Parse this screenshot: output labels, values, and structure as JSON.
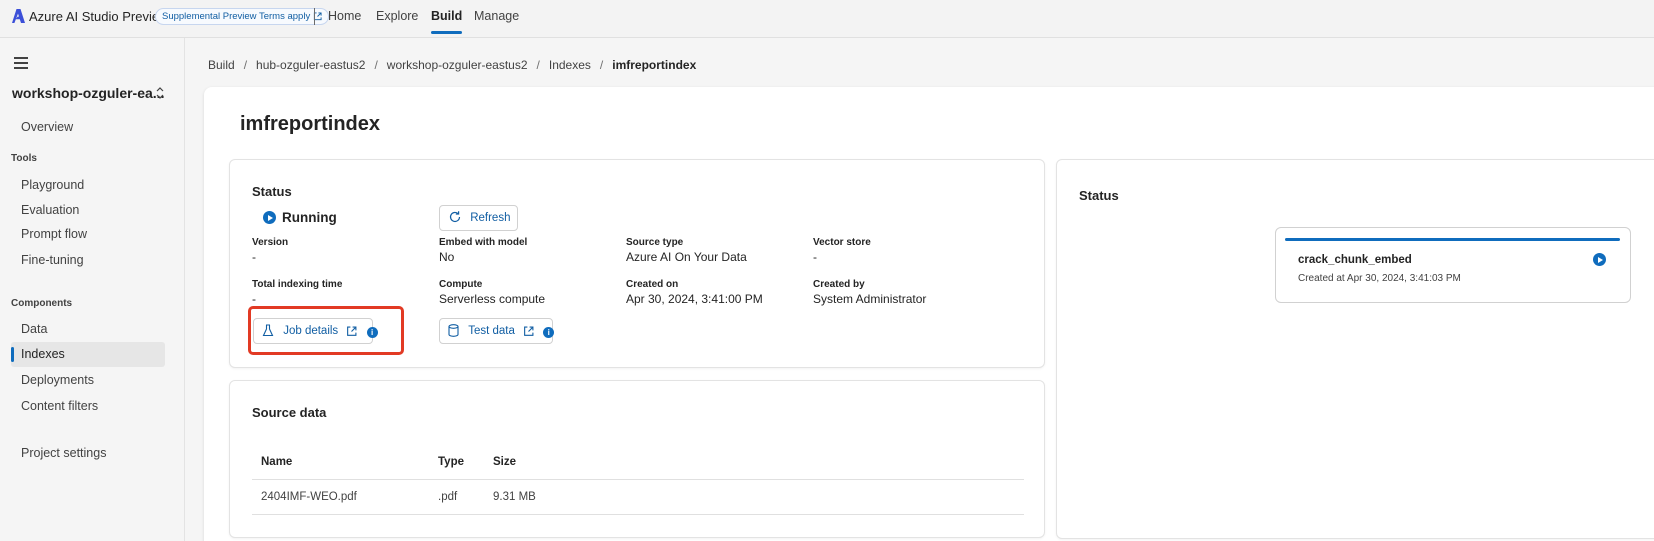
{
  "topbar": {
    "app_title": "Azure AI Studio Preview",
    "preview_pill": "Supplemental Preview Terms apply",
    "nav": [
      "Home",
      "Explore",
      "Build",
      "Manage"
    ],
    "active_nav": "Build"
  },
  "sidebar": {
    "project_name": "workshop-ozguler-ea...",
    "overview": "Overview",
    "tools_heading": "Tools",
    "tools": [
      "Playground",
      "Evaluation",
      "Prompt flow",
      "Fine-tuning"
    ],
    "components_heading": "Components",
    "components": [
      "Data",
      "Indexes",
      "Deployments",
      "Content filters"
    ],
    "selected": "Indexes",
    "project_settings": "Project settings"
  },
  "breadcrumb": [
    "Build",
    "hub-ozguler-eastus2",
    "workshop-ozguler-eastus2",
    "Indexes",
    "imfreportindex"
  ],
  "page_title": "imfreportindex",
  "status_card": {
    "title": "Status",
    "state": "Running",
    "refresh_label": "Refresh",
    "fields": {
      "version_label": "Version",
      "version_value": "-",
      "embed_label": "Embed with model",
      "embed_value": "No",
      "source_type_label": "Source type",
      "source_type_value": "Azure AI On Your Data",
      "vector_store_label": "Vector store",
      "vector_store_value": "-",
      "indexing_time_label": "Total indexing time",
      "indexing_time_value": "-",
      "compute_label": "Compute",
      "compute_value": "Serverless compute",
      "created_on_label": "Created on",
      "created_on_value": "Apr 30, 2024, 3:41:00 PM",
      "created_by_label": "Created by",
      "created_by_value": "System Administrator"
    },
    "job_details_label": "Job details",
    "test_data_label": "Test data"
  },
  "source_data": {
    "title": "Source data",
    "columns": [
      "Name",
      "Type",
      "Size"
    ],
    "rows": [
      {
        "name": "2404IMF-WEO.pdf",
        "type": ".pdf",
        "size": "9.31 MB"
      }
    ]
  },
  "right_panel": {
    "title": "Status",
    "job": {
      "name": "crack_chunk_embed",
      "created": "Created at Apr 30, 2024, 3:41:03 PM",
      "status_icon": "play-circle-icon"
    }
  },
  "colors": {
    "accent": "#0f6cbd",
    "highlight": "#e23a24"
  }
}
